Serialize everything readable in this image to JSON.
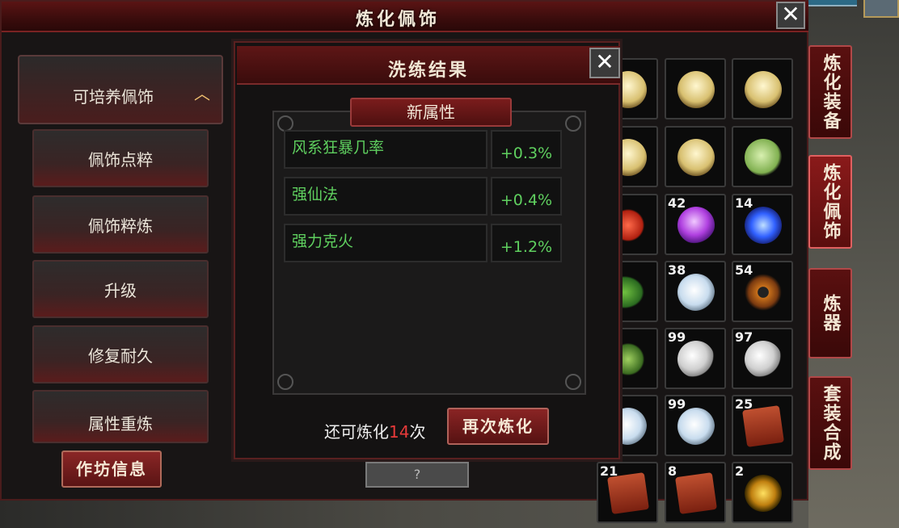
{
  "window": {
    "title": "炼化佩饰",
    "close_icon": "close-icon"
  },
  "nav": {
    "header": {
      "label": "可培养佩饰",
      "chevron": "︿"
    },
    "items": [
      {
        "label": "佩饰点粹"
      },
      {
        "label": "佩饰粹炼"
      },
      {
        "label": "升级"
      },
      {
        "label": "修复耐久"
      },
      {
        "label": "属性重炼"
      }
    ],
    "workshop_button": "作坊信息"
  },
  "side_tabs": [
    {
      "label": "炼化装备",
      "active": false
    },
    {
      "label": "炼化佩饰",
      "active": true
    },
    {
      "label": "炼器",
      "active": false
    },
    {
      "label": "套装合成",
      "active": false
    }
  ],
  "bottom_tab": "?",
  "inventory": {
    "slots": [
      {
        "icon": "lantern-icon",
        "count": ""
      },
      {
        "icon": "lantern-icon",
        "count": ""
      },
      {
        "icon": "lantern-icon",
        "count": ""
      },
      {
        "icon": "lantern-icon",
        "count": ""
      },
      {
        "icon": "lantern-icon",
        "count": ""
      },
      {
        "icon": "jade-icon",
        "count": ""
      },
      {
        "icon": "red-fruit-icon",
        "count": ""
      },
      {
        "icon": "purple-orb-icon",
        "count": "42"
      },
      {
        "icon": "blue-crystal-icon",
        "count": "14"
      },
      {
        "icon": "leaf-icon",
        "count": ""
      },
      {
        "icon": "white-crystal-icon",
        "count": "38"
      },
      {
        "icon": "bagua-icon",
        "count": "54"
      },
      {
        "icon": "herb-icon",
        "count": ""
      },
      {
        "icon": "silver-pearl-icon",
        "count": "99"
      },
      {
        "icon": "silver-pearl-icon",
        "count": "97"
      },
      {
        "icon": "white-crystal-icon",
        "count": ""
      },
      {
        "icon": "white-crystal-icon",
        "count": "99"
      },
      {
        "icon": "chest-icon",
        "count": "25"
      },
      {
        "icon": "chest-icon",
        "count": "21"
      },
      {
        "icon": "chest-icon",
        "count": "8"
      },
      {
        "icon": "gold-orb-icon",
        "count": "2"
      }
    ]
  },
  "dialog": {
    "title": "洗练结果",
    "close_icon": "close-icon",
    "section_title": "新属性",
    "attributes": [
      {
        "name": "风系狂暴几率",
        "value": "+0.3%"
      },
      {
        "name": "强仙法",
        "value": "+0.4%"
      },
      {
        "name": "强力克火",
        "value": "+1.2%"
      }
    ],
    "remaining_prefix": "还可炼化",
    "remaining_count": "14",
    "remaining_suffix": "次",
    "again_button": "再次炼化"
  }
}
